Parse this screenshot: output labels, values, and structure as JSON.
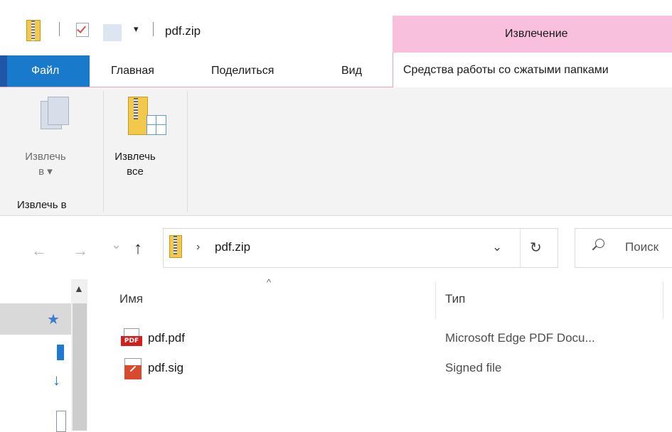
{
  "window": {
    "title": "pdf.zip",
    "qat_dropdown": "▾",
    "contextual_header": "Извлечение"
  },
  "ribbon_tabs": {
    "file": "Файл",
    "home": "Главная",
    "share": "Поделиться",
    "view": "Вид",
    "compressed_tools": "Средства работы со сжатыми папками"
  },
  "ribbon": {
    "extract_to_line1": "Извлечь",
    "extract_to_line2": "в ▾",
    "extract_all_line1": "Извлечь",
    "extract_all_line2": "все",
    "group_label": "Извлечь в"
  },
  "navigation": {
    "back": "←",
    "forward": "→",
    "recent": "⌄",
    "up": "↑"
  },
  "address_bar": {
    "separator": "›",
    "path": "pdf.zip",
    "dropdown": "⌄",
    "refresh": "↻"
  },
  "search": {
    "placeholder": "Поиск"
  },
  "file_list": {
    "sort_indicator": "^",
    "columns": {
      "name": "Имя",
      "type": "Тип"
    },
    "rows": [
      {
        "name": "pdf.pdf",
        "type": "Microsoft Edge PDF Docu...",
        "icon": "pdf-file-icon"
      },
      {
        "name": "pdf.sig",
        "type": "Signed file",
        "icon": "signed-file-icon"
      }
    ]
  },
  "pdf_icon_label": "PDF",
  "colors": {
    "file_tab": "#1979ca",
    "contextual_tab": "#f8c0dc",
    "ribbon_bg": "#f3f3f3"
  }
}
